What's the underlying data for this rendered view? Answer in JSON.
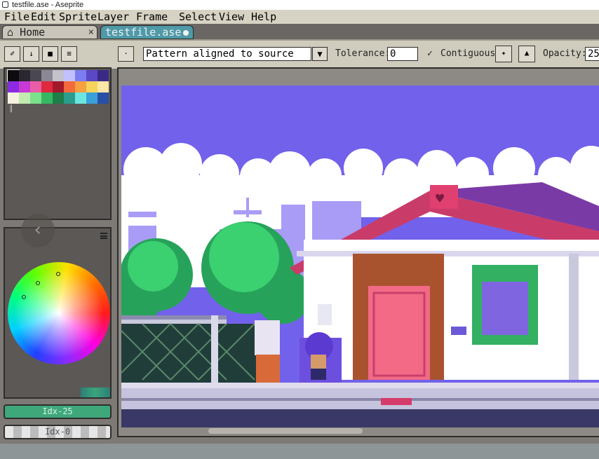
{
  "window": {
    "title": "testfile.ase - Aseprite"
  },
  "menu": [
    {
      "label": "File"
    },
    {
      "label": "Edit"
    },
    {
      "label": "Sprite"
    },
    {
      "label": "Layer"
    },
    {
      "label": "Frame"
    },
    {
      "label": "Select"
    },
    {
      "label": "View"
    },
    {
      "label": "Help"
    }
  ],
  "tabs": {
    "home": {
      "label": "Home",
      "close": "×"
    },
    "file": {
      "label": "testfile.ase"
    }
  },
  "toolbar": {
    "pattern_value": "Pattern aligned to source",
    "tolerance_label": "Tolerance:",
    "tolerance_value": "0",
    "contiguous_label": "Contiguous",
    "opacity_label": "Opacity:",
    "opacity_value": "25"
  },
  "palette": {
    "colors": [
      "#0d0b0e",
      "#2a2730",
      "#4a4753",
      "#8a8893",
      "#c4c3cc",
      "#c2c0ff",
      "#7c7df0",
      "#5a48c6",
      "#3a2a86",
      "#8a2be2",
      "#c83ad6",
      "#e85da5",
      "#e0283f",
      "#a3182a",
      "#f26a3a",
      "#f5a041",
      "#f6d35a",
      "#fde7a6",
      "#f7f2e0",
      "#c2ebb0",
      "#7be08a",
      "#35b862",
      "#1f7d4a",
      "#2a9d8f",
      "#6ee6e0",
      "#3aa0d8",
      "#2850a8"
    ]
  },
  "colors": {
    "foreground_label": "Idx-25",
    "background_label": "Idx-0"
  }
}
